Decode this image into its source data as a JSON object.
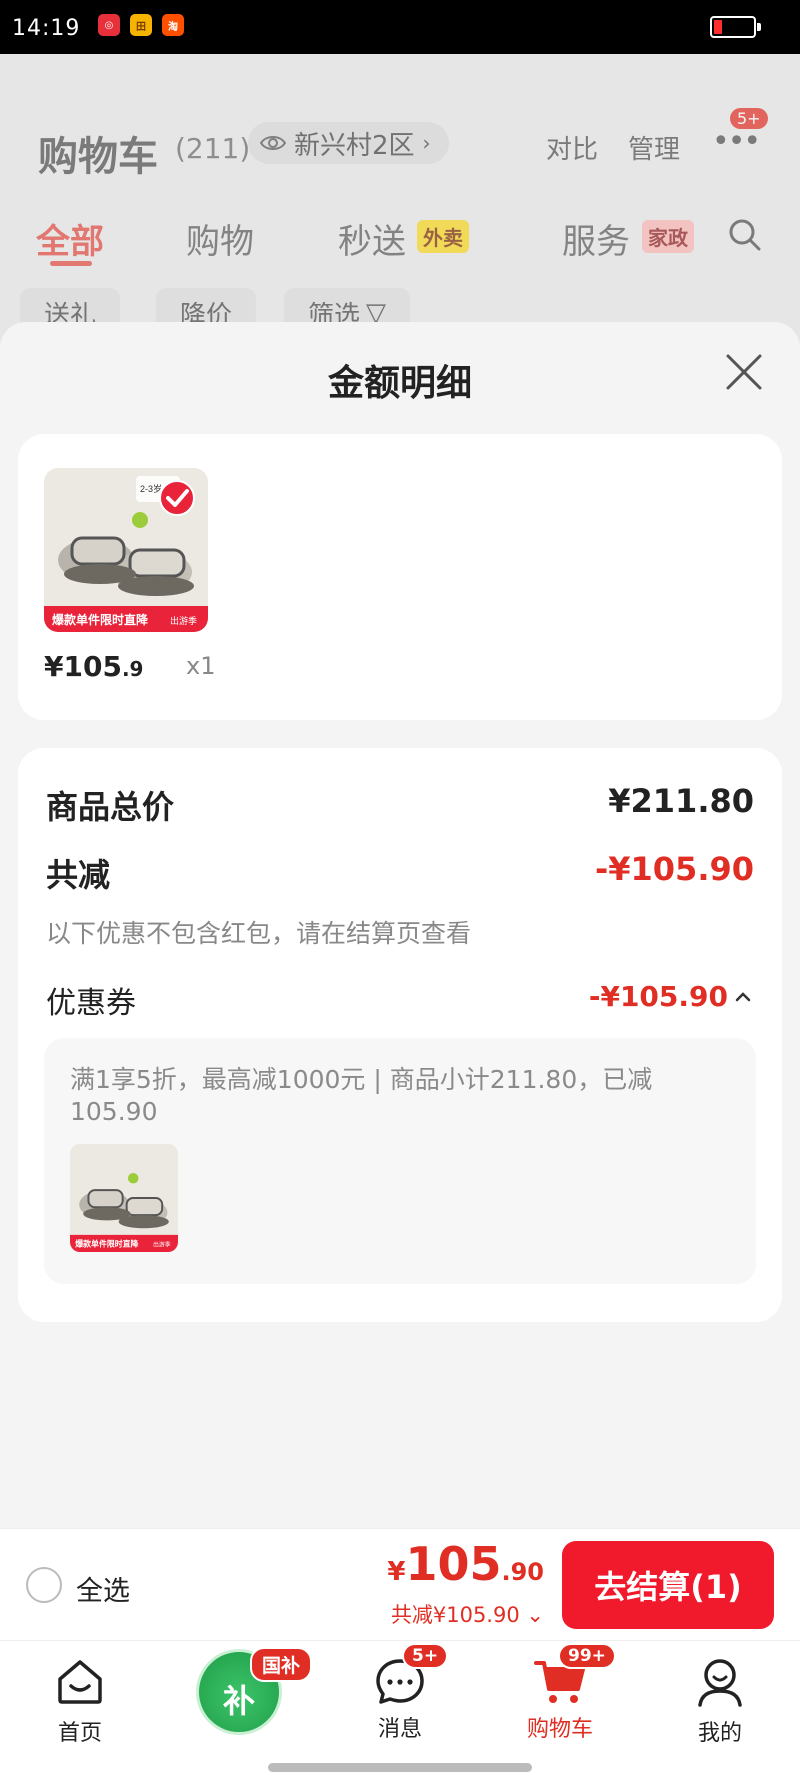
{
  "status_bar": {
    "time": "14:19",
    "app_icons": [
      {
        "name": "netease-music-icon",
        "color": "#e8303a",
        "glyph": "◎"
      },
      {
        "name": "tianmao-icon",
        "color": "#f5b400",
        "glyph": "田"
      },
      {
        "name": "taobao-icon",
        "color": "#ff5000",
        "glyph": "淘"
      }
    ]
  },
  "background_app": {
    "title": "购物车",
    "count": "(211)",
    "location": "新兴村2区",
    "compare": "对比",
    "manage": "管理",
    "more_badge": "5+",
    "tabs": [
      "全部",
      "购物",
      "秒送",
      "服务"
    ],
    "tab_tag_1": "外卖",
    "tab_tag_2": "家政",
    "chips": [
      "送礼",
      "降价",
      "筛选"
    ]
  },
  "sheet": {
    "title": "金额明细",
    "product": {
      "price_int": "¥105",
      "price_dec": ".9",
      "qty": "x1",
      "thumb_banner": "爆款单件限时直降",
      "thumb_brand": "出游季",
      "thumb_tag": "2-3岁"
    },
    "summary": {
      "total_label": "商品总价",
      "total_value": "¥211.80",
      "discount_label": "共减",
      "discount_value": "-¥105.90",
      "note": "以下优惠不包含红包，请在结算页查看",
      "coupon_label": "优惠券",
      "coupon_value": "-¥105.90",
      "coupon_desc": "满1享5折，最高减1000元 | 商品小计211.80，已减105.90"
    }
  },
  "checkout": {
    "select_all": "全选",
    "price_currency": "¥",
    "price_int": "105",
    "price_dec": ".90",
    "discount": "共减¥105.90",
    "button": "去结算(1)"
  },
  "nav": {
    "items": [
      {
        "label": "首页",
        "icon": "home-icon"
      },
      {
        "label": "消息",
        "icon": "message-icon",
        "badge": "5+"
      },
      {
        "label": "购物车",
        "icon": "cart-icon",
        "badge": "99+"
      },
      {
        "label": "我的",
        "icon": "profile-icon"
      }
    ],
    "subsidy_badge": "国补",
    "subsidy_char": "补"
  },
  "colors": {
    "accent": "#e02e24",
    "button": "#f01a2c"
  }
}
